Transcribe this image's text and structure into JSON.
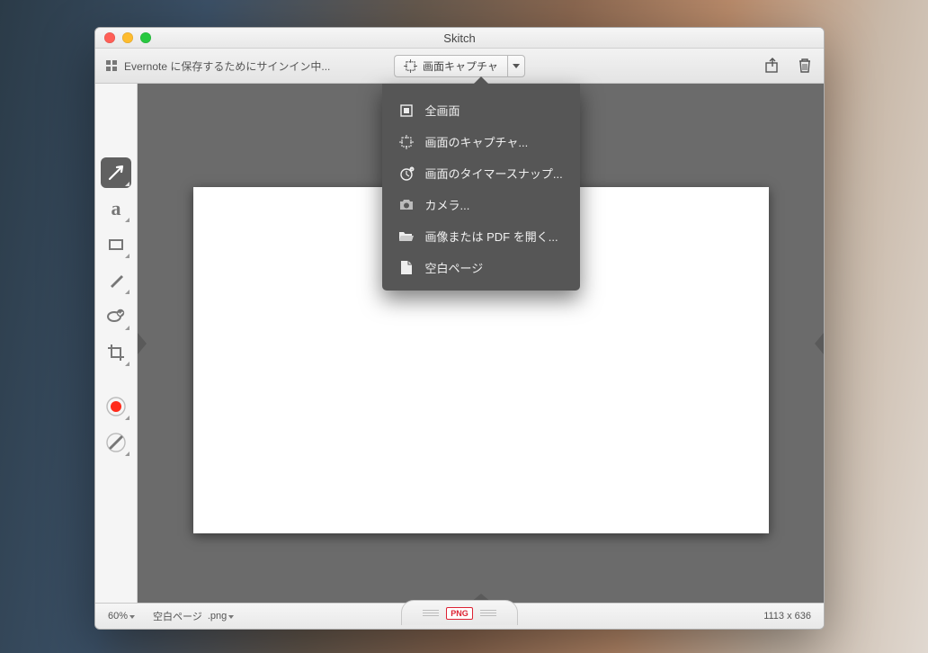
{
  "window": {
    "title": "Skitch"
  },
  "toolbar": {
    "evernote_status": "Evernote に保存するためにサインイン中...",
    "capture_label": "画面キャプチャ"
  },
  "capture_menu": {
    "items": [
      {
        "label": "全画面",
        "icon": "fullscreen"
      },
      {
        "label": "画面のキャプチャ...",
        "icon": "crosshair"
      },
      {
        "label": "画面のタイマースナップ...",
        "icon": "timer"
      },
      {
        "label": "カメラ...",
        "icon": "camera"
      },
      {
        "label": "画像または PDF を開く...",
        "icon": "folder"
      },
      {
        "label": "空白ページ",
        "icon": "blank"
      }
    ]
  },
  "tools": [
    {
      "name": "arrow",
      "active": true
    },
    {
      "name": "text",
      "active": false
    },
    {
      "name": "shape",
      "active": false
    },
    {
      "name": "marker",
      "active": false
    },
    {
      "name": "pixelate",
      "active": false
    },
    {
      "name": "crop",
      "active": false
    }
  ],
  "status": {
    "zoom": "60%",
    "doc_name": "空白ページ",
    "extension": ".png",
    "file_badge": "PNG",
    "dimensions": "1113 x 636"
  }
}
